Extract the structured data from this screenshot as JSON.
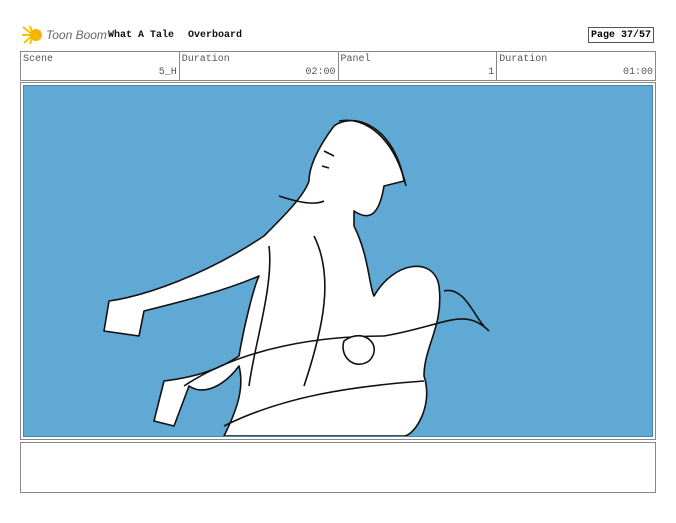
{
  "header": {
    "brand": "Toon Boom",
    "project": "What A Tale",
    "sequence": "Overboard",
    "page": "Page 37/57"
  },
  "info": [
    {
      "label": "Scene",
      "value": "5_H"
    },
    {
      "label": "Duration",
      "value": "02:00"
    },
    {
      "label": "Panel",
      "value": "1"
    },
    {
      "label": "Duration",
      "value": "01:00"
    }
  ],
  "colors": {
    "background": "#5fa9d4"
  }
}
